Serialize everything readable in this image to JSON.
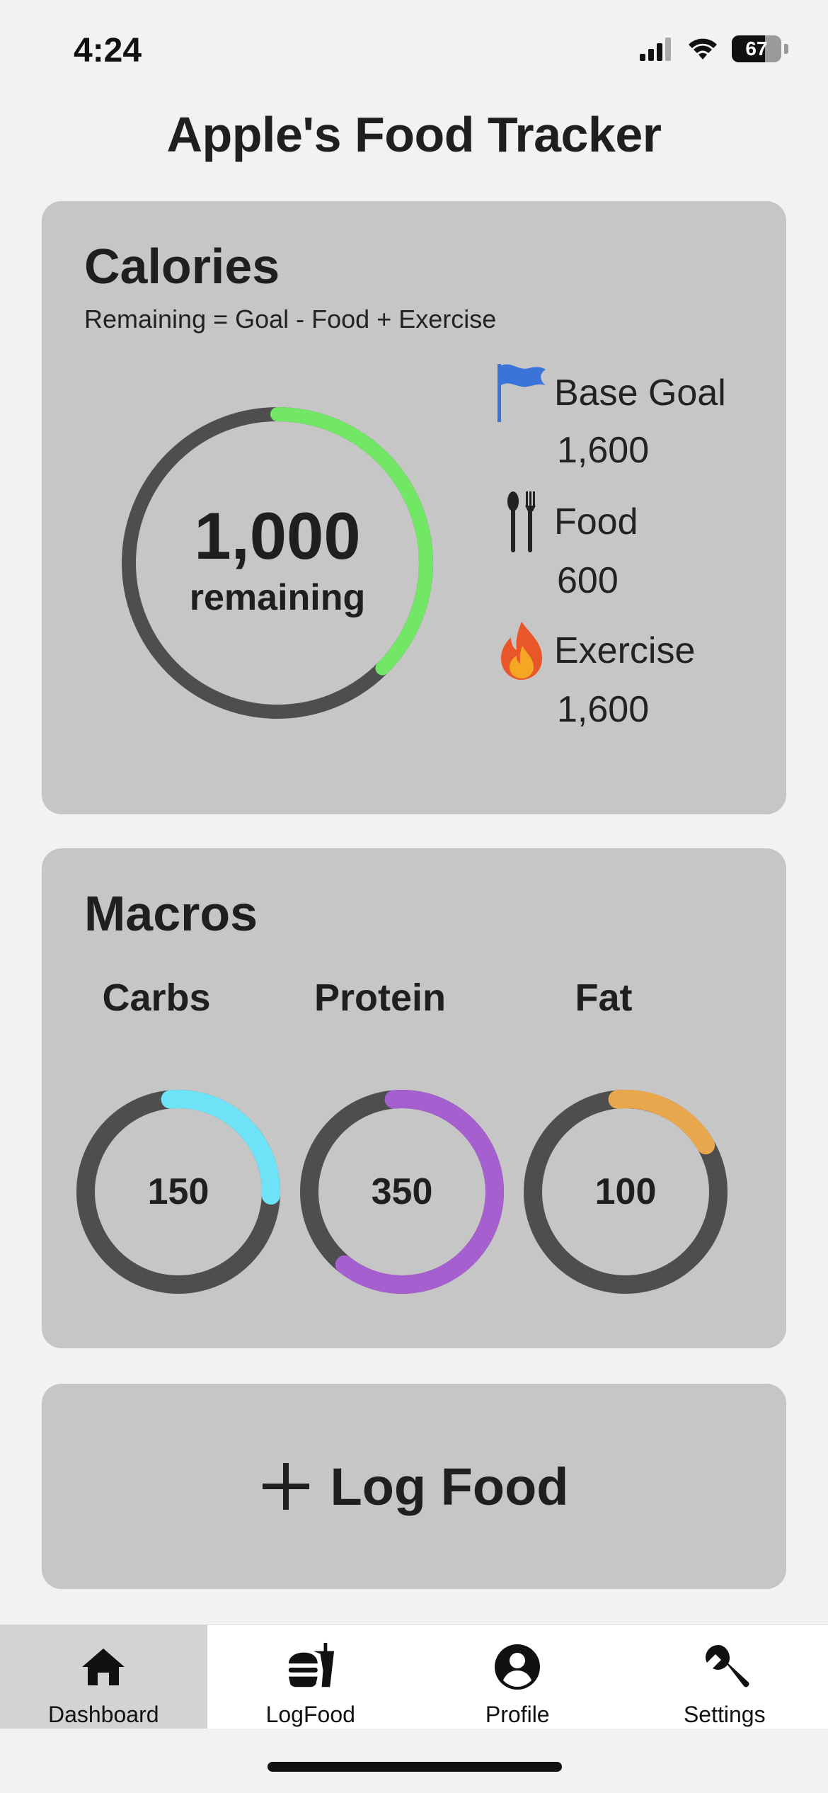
{
  "status_bar": {
    "time": "4:24",
    "battery": "67"
  },
  "app": {
    "title": "Apple's Food Tracker"
  },
  "calories": {
    "title": "Calories",
    "formula": "Remaining = Goal - Food + Exercise",
    "remaining_value": "1,000",
    "remaining_label": "remaining",
    "ring_progress": 0.375,
    "ring_color": "#72e765",
    "stats": [
      {
        "icon": "flag-icon",
        "label": "Base Goal",
        "value": "1,600"
      },
      {
        "icon": "fork-knife-icon",
        "label": "Food",
        "value": "600"
      },
      {
        "icon": "fire-icon",
        "label": "Exercise",
        "value": "1,600"
      }
    ]
  },
  "macros": {
    "title": "Macros",
    "items": [
      {
        "label": "Carbs",
        "value": "150",
        "progress": 0.27,
        "color": "#6ee2f6"
      },
      {
        "label": "Protein",
        "value": "350",
        "progress": 0.62,
        "color": "#a55fcf"
      },
      {
        "label": "Fat",
        "value": "100",
        "progress": 0.18,
        "color": "#e8a74d"
      }
    ]
  },
  "log_food": {
    "label": "Log Food"
  },
  "tab_bar": {
    "tabs": [
      {
        "label": "Dashboard",
        "icon": "home-icon",
        "active": true
      },
      {
        "label": "LogFood",
        "icon": "fastfood-icon",
        "active": false
      },
      {
        "label": "Profile",
        "icon": "profile-icon",
        "active": false
      },
      {
        "label": "Settings",
        "icon": "wrench-icon",
        "active": false
      }
    ]
  },
  "colors": {
    "track": "#4e4e4e",
    "card": "#c6c6c6",
    "background": "#f2f2f2",
    "flag": "#3b74d9"
  }
}
